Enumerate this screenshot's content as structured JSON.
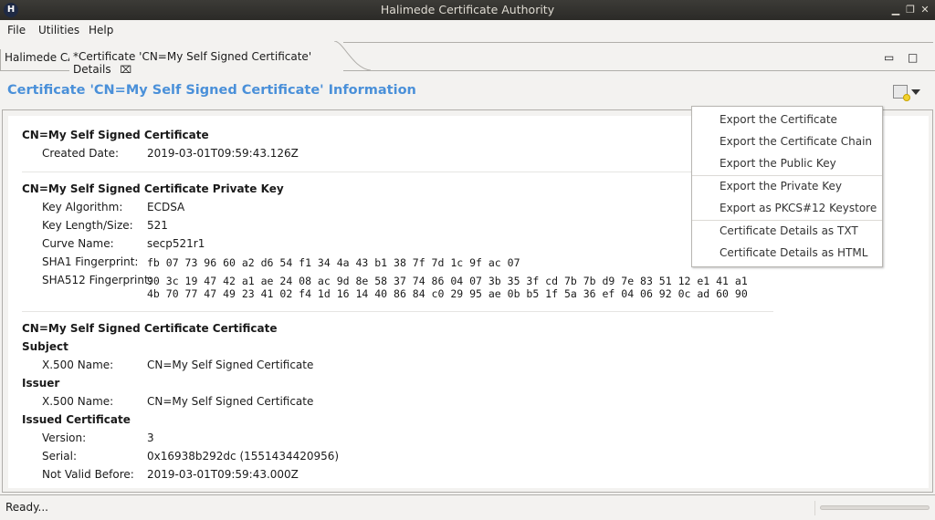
{
  "window": {
    "title": "Halimede Certificate Authority",
    "app_icon_letter": "H",
    "minimize_glyph": "▁",
    "restore_glyph": "❐",
    "close_glyph": "✕"
  },
  "menu": [
    "File",
    "Utilities",
    "Help"
  ],
  "tabs": [
    {
      "label": "Halimede CA",
      "active": false
    },
    {
      "label": "*Certificate 'CN=My Self Signed Certificate' Details",
      "active": true,
      "close_glyph": "⌧"
    }
  ],
  "view_controls": {
    "minimize_glyph": "▭",
    "maximize_glyph": "□"
  },
  "page": {
    "title": "Certificate 'CN=My Self Signed Certificate' Information",
    "toolbar_icon": "certificate-icon",
    "dropdown_icon": "chevron-down-icon"
  },
  "sections": {
    "summary": {
      "title": "CN=My Self Signed Certificate",
      "rows": [
        {
          "label": "Created Date:",
          "value": "2019-03-01T09:59:43.126Z"
        }
      ]
    },
    "private_key": {
      "title": "CN=My Self Signed Certificate Private Key",
      "rows": [
        {
          "label": "Key Algorithm:",
          "value": "ECDSA"
        },
        {
          "label": "Key Length/Size:",
          "value": "521"
        },
        {
          "label": "Curve Name:",
          "value": "secp521r1"
        },
        {
          "label": "SHA1 Fingerprint:",
          "value": "fb 07 73 96 60 a2 d6 54 f1 34 4a 43 b1 38 7f 7d 1c 9f ac 07"
        },
        {
          "label": "SHA512 Fingerprint:",
          "value": "90 3c 19 47 42 a1 ae 24 08 ac 9d 8e 58 37 74 86 04 07 3b 35 3f cd 7b 7b d9 7e 83 51 12 e1 41 a1\n4b 70 77 47 49 23 41 02 f4 1d 16 14 40 86 84 c0 29 95 ae 0b b5 1f 5a 36 ef 04 06 92 0c ad 60 90"
        }
      ]
    },
    "certificate": {
      "title": "CN=My Self Signed Certificate Certificate",
      "subject_heading": "Subject",
      "subject_rows": [
        {
          "label": "X.500 Name:",
          "value": "CN=My Self Signed Certificate"
        }
      ],
      "issuer_heading": "Issuer",
      "issuer_rows": [
        {
          "label": "X.500 Name:",
          "value": "CN=My Self Signed Certificate"
        }
      ],
      "issued_heading": "Issued Certificate",
      "issued_rows": [
        {
          "label": "Version:",
          "value": "3"
        },
        {
          "label": "Serial:",
          "value": "0x16938b292dc (1551434420956)"
        },
        {
          "label": "Not Valid Before:",
          "value": "2019-03-01T09:59:43.000Z"
        }
      ]
    }
  },
  "export_menu": {
    "groups": [
      [
        "Export the Certificate",
        "Export the Certificate Chain",
        "Export the Public Key"
      ],
      [
        "Export the Private Key",
        "Export as PKCS#12 Keystore"
      ],
      [
        "Certificate Details as TXT",
        "Certificate Details as HTML"
      ]
    ]
  },
  "status": {
    "text": "Ready...",
    "progress_percent": 0
  }
}
